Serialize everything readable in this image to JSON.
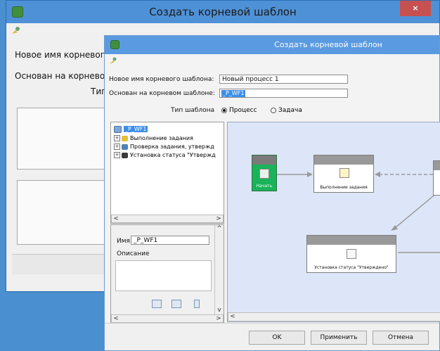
{
  "back_window": {
    "title": "Создать корневой шаблон",
    "close_symbol": "×",
    "labels": {
      "new_name": "Новое имя корневого",
      "based_on": "Основан на корневом",
      "type": "Тип"
    }
  },
  "window": {
    "title": "Создать корневой шаблон",
    "form": {
      "new_name_label": "Новое имя корневого шаблона:",
      "new_name_value": "Новый процесс 1",
      "based_on_label": "Основан на корневом шаблоне:",
      "based_on_value": "_P_WF1",
      "type_label": "Тип шаблона",
      "type_options": [
        "Процесс",
        "Задача"
      ],
      "type_selected": "Процесс"
    },
    "tree": {
      "root": "_P_WF1",
      "children": [
        {
          "label": "Выполнение задания",
          "icon": "gear-icon"
        },
        {
          "label": "Проверка задания, утвержд",
          "icon": "check-task-icon"
        },
        {
          "label": "Установка статуса \"Утвержд",
          "icon": "flag-icon"
        }
      ]
    },
    "props": {
      "name_label": "Имя:",
      "name_value": "_P_WF1",
      "description_label": "Описание"
    },
    "diagram": {
      "nodes": [
        {
          "label": "Начать",
          "icon": "start-icon"
        },
        {
          "label": "Выполнение задания",
          "icon": "gear-icon"
        },
        {
          "label": "Установка статуса \"Утверждено\"",
          "icon": "flag-icon"
        }
      ]
    },
    "buttons": {
      "ok": "OK",
      "apply": "Применить",
      "cancel": "Отмена"
    },
    "scroll": {
      "left": "<",
      "right": ">",
      "up": "^",
      "down": "v"
    }
  }
}
